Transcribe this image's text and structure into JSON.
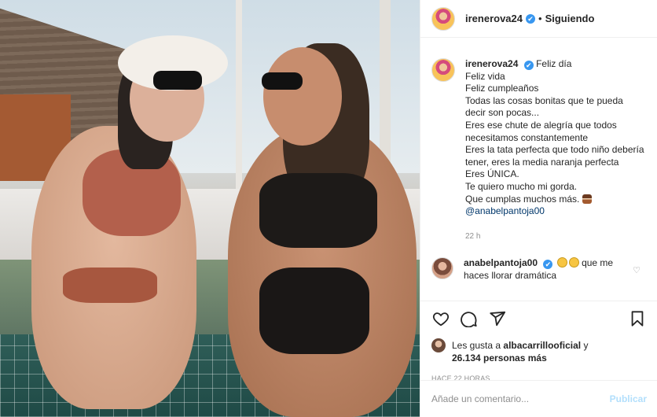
{
  "post": {
    "username": "irenerova24",
    "follow_status": "Siguiendo",
    "separator": "•",
    "verified_mark": "✔"
  },
  "caption": {
    "username": "irenerova24",
    "lines": [
      "Feliz día",
      "Feliz vida",
      "Feliz cumpleaños",
      "Todas las cosas bonitas que te pueda decir son pocas...",
      "Eres ese chute de alegría que todos necesitamos constantemente",
      "Eres la tata perfecta que todo niño debería tener, eres la media naranja perfecta",
      "Eres ÚNICA.",
      "Te quiero mucho mi gorda.",
      "Que cumplas muchos más."
    ],
    "mention": "@anabelpantoja00",
    "time": "22 h",
    "emoji": "birthday-cake"
  },
  "comment": {
    "username": "anabelpantoja00",
    "text": "que me haces llorar dramática",
    "emojis": [
      "weary-face",
      "weary-face"
    ]
  },
  "likes": {
    "prefix": "Les gusta a",
    "user": "albacarrillooficial",
    "joiner": "y",
    "count": "26.134 personas más"
  },
  "timestamp": "HACE 22 HORAS",
  "add_comment": {
    "placeholder": "Añade un comentario...",
    "publish_label": "Publicar"
  },
  "colors": {
    "verified": "#3897f0",
    "mention": "#00376b",
    "publish_disabled": "#b2dffc",
    "muted": "#8e8e8e"
  }
}
